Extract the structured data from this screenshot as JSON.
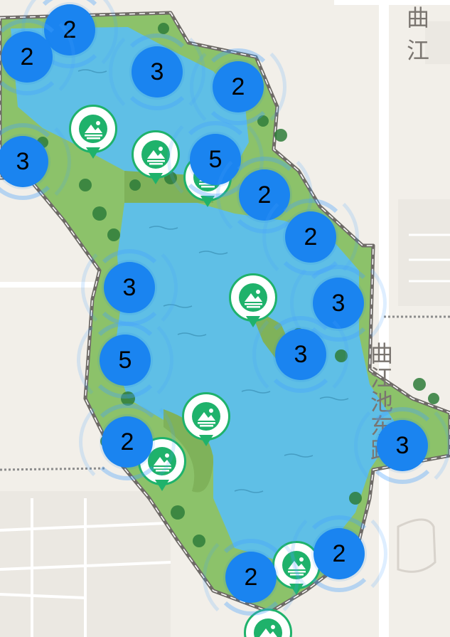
{
  "map": {
    "road_labels": {
      "top_right": "曲江",
      "east_road": "曲江池东路"
    },
    "clusters": [
      {
        "count": "2"
      },
      {
        "count": "2"
      },
      {
        "count": "3"
      },
      {
        "count": "2"
      },
      {
        "count": "3"
      },
      {
        "count": "5"
      },
      {
        "count": "2"
      },
      {
        "count": "2"
      },
      {
        "count": "3"
      },
      {
        "count": "3"
      },
      {
        "count": "5"
      },
      {
        "count": "3"
      },
      {
        "count": "2"
      },
      {
        "count": "2"
      },
      {
        "count": "2"
      },
      {
        "count": "3"
      }
    ],
    "pins": [
      {
        "icon": "scenic-mountain-icon"
      },
      {
        "icon": "scenic-mountain-icon"
      },
      {
        "icon": "scenic-mountain-icon"
      },
      {
        "icon": "scenic-mountain-icon"
      },
      {
        "icon": "scenic-mountain-icon"
      },
      {
        "icon": "scenic-mountain-icon"
      },
      {
        "icon": "scenic-mountain-icon"
      },
      {
        "icon": "scenic-mountain-icon"
      }
    ],
    "colors": {
      "cluster": "#1a84f0",
      "pin": "#1fb26b",
      "water": "#5fbfe6",
      "park": "#5aa84a",
      "background": "#f2efe9"
    }
  }
}
